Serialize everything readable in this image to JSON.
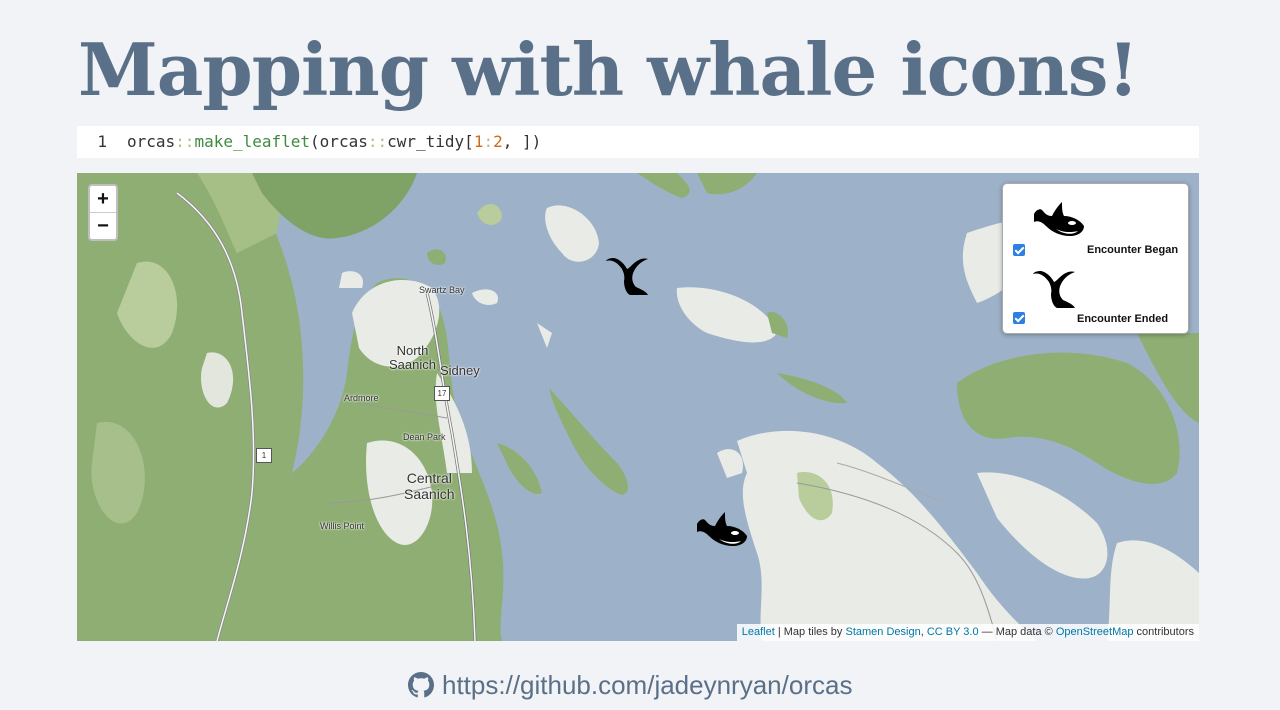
{
  "slide": {
    "title": "Mapping with whale icons!",
    "code": {
      "line_number": "1",
      "ns1": "orcas",
      "op1": "::",
      "fn": "make_leaflet",
      "paren_open": "(",
      "ns2": "orcas",
      "op2": "::",
      "arg_fn": "cwr_tidy",
      "bracket_open": "[",
      "range_start": "1",
      "range_colon": ":",
      "range_end": "2",
      "tail": ", ])"
    },
    "github_url": "https://github.com/jadeynryan/orcas"
  },
  "map": {
    "zoom_in": "+",
    "zoom_out": "−",
    "legend": {
      "items": [
        {
          "label": "Encounter Began",
          "checked": true,
          "icon": "orca-icon"
        },
        {
          "label": "Encounter Ended",
          "checked": true,
          "icon": "whale-tail-icon"
        }
      ]
    },
    "markers": [
      {
        "icon": "whale-tail-icon"
      },
      {
        "icon": "orca-icon"
      }
    ],
    "place_labels": {
      "swartz_bay": "Swartz Bay",
      "north": "North",
      "saanich": "Saanich",
      "sidney": "Sidney",
      "ardmore": "Ardmore",
      "dean_park": "Dean Park",
      "central": "Central",
      "saanich2": "Saanich",
      "willis_point": "Willis Point",
      "hwy17": "17",
      "hwy1": "1"
    },
    "attribution": {
      "leaflet": "Leaflet",
      "sep1": " | Map tiles by ",
      "stamen": "Stamen Design",
      "comma": ", ",
      "license": "CC BY 3.0",
      "data": " — Map data © ",
      "osm": "OpenStreetMap",
      "contrib": " contributors"
    },
    "colors": {
      "water": "#9db1c8",
      "land": "#e9ebe6",
      "forest": "#8fae74",
      "link": "#0078a8"
    }
  }
}
